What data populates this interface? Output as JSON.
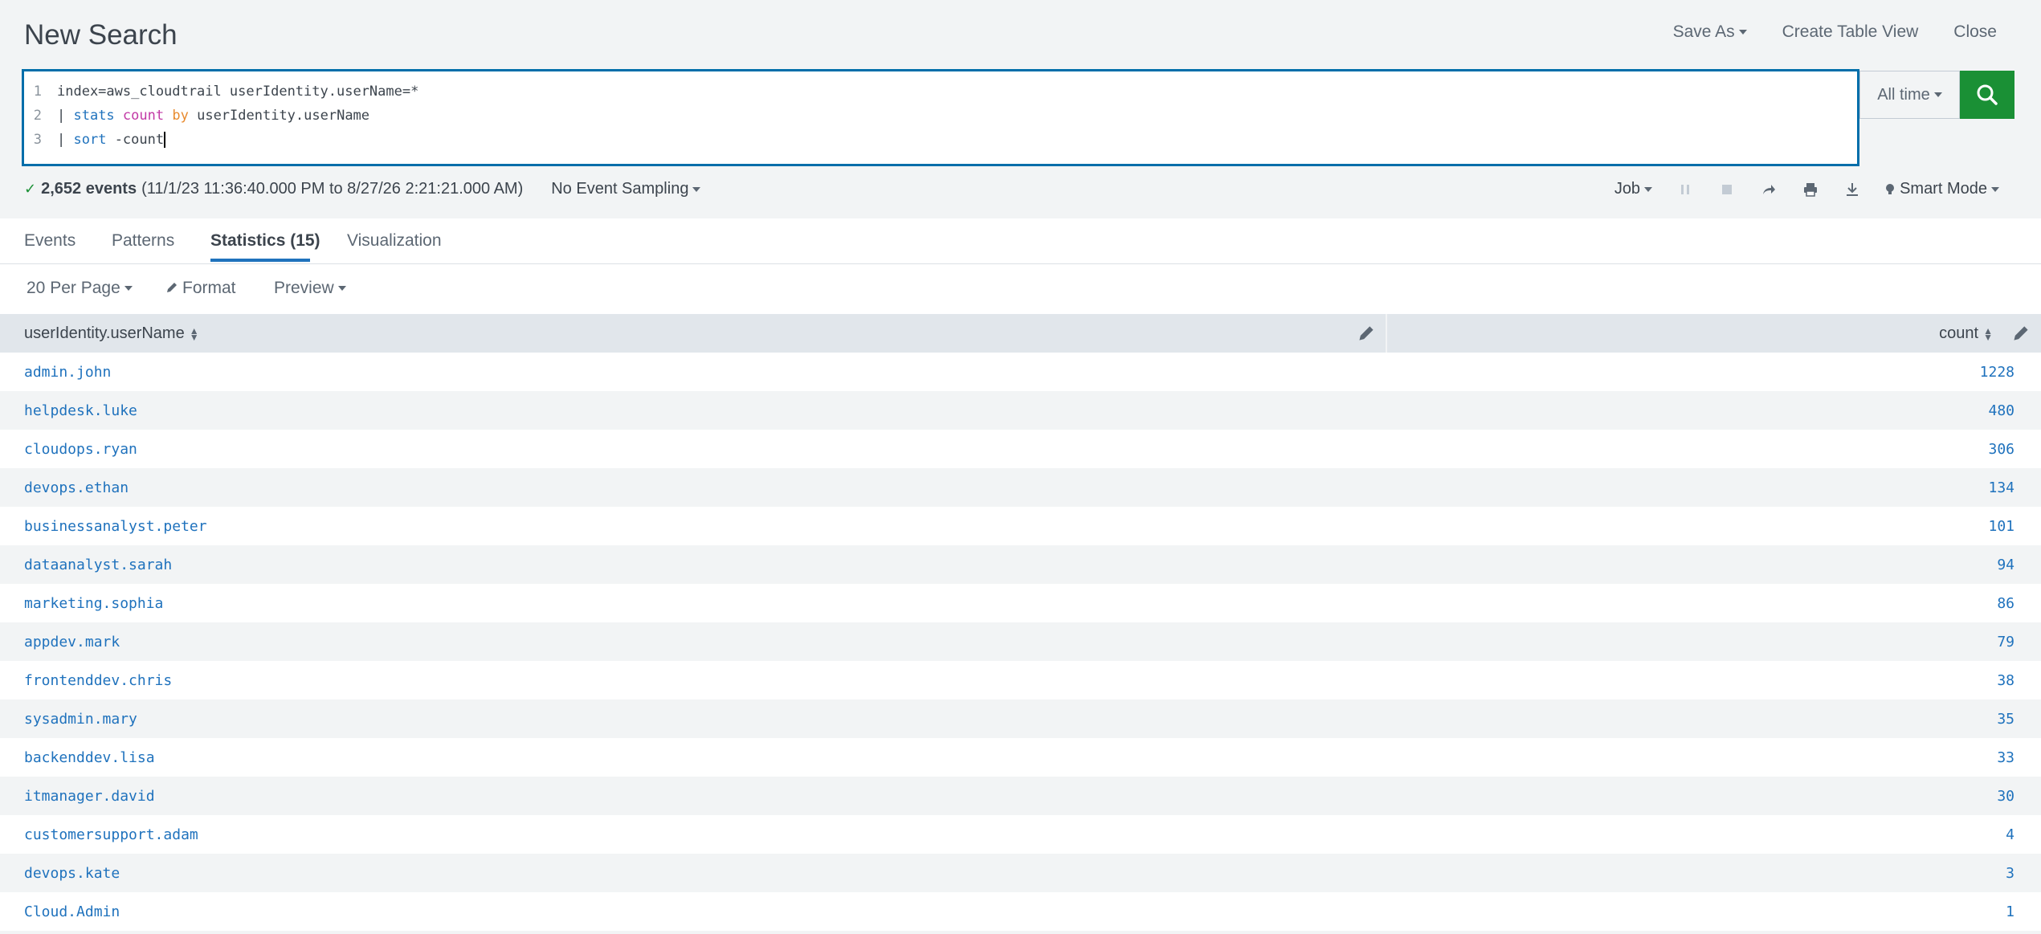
{
  "header": {
    "title": "New Search",
    "save_as": "Save As",
    "create_table_view": "Create Table View",
    "close": "Close"
  },
  "query": {
    "line_numbers": [
      "1",
      "2",
      "3"
    ],
    "line1": "index=aws_cloudtrail userIdentity.userName=*",
    "line2": {
      "pipe": "| ",
      "cmd": "stats",
      "fn": "count",
      "kw": "by",
      "field": "userIdentity.userName"
    },
    "line3": {
      "pipe": "| ",
      "cmd": "sort",
      "arg": "-count"
    }
  },
  "time_picker": {
    "label": "All time"
  },
  "status": {
    "events_count": "2,652 events",
    "events_range": "(11/1/23 11:36:40.000 PM to 8/27/26 2:21:21.000 AM)",
    "sampling": "No Event Sampling",
    "job": "Job",
    "mode": "Smart Mode"
  },
  "tabs": [
    {
      "label": "Events"
    },
    {
      "label": "Patterns"
    },
    {
      "label": "Statistics (15)"
    },
    {
      "label": "Visualization"
    }
  ],
  "active_tab": "Statistics (15)",
  "controls": {
    "per_page": "20 Per Page",
    "format": "Format",
    "preview": "Preview"
  },
  "table": {
    "columns": [
      "userIdentity.userName",
      "count"
    ],
    "rows": [
      {
        "name": "admin.john",
        "count": "1228"
      },
      {
        "name": "helpdesk.luke",
        "count": "480"
      },
      {
        "name": "cloudops.ryan",
        "count": "306"
      },
      {
        "name": "devops.ethan",
        "count": "134"
      },
      {
        "name": "businessanalyst.peter",
        "count": "101"
      },
      {
        "name": "dataanalyst.sarah",
        "count": "94"
      },
      {
        "name": "marketing.sophia",
        "count": "86"
      },
      {
        "name": "appdev.mark",
        "count": "79"
      },
      {
        "name": "frontenddev.chris",
        "count": "38"
      },
      {
        "name": "sysadmin.mary",
        "count": "35"
      },
      {
        "name": "backenddev.lisa",
        "count": "33"
      },
      {
        "name": "itmanager.david",
        "count": "30"
      },
      {
        "name": "customersupport.adam",
        "count": "4"
      },
      {
        "name": "devops.kate",
        "count": "3"
      },
      {
        "name": "Cloud.Admin",
        "count": "1"
      }
    ]
  },
  "colors": {
    "accent": "#006eaa",
    "search_button": "#1a9035",
    "link": "#1f72bd",
    "spl_command": "#1f72bd",
    "spl_function": "#c239a6",
    "spl_keyword": "#e88b2f"
  },
  "icons": {
    "search": "magnifier-icon",
    "pause": "pause-icon",
    "stop": "stop-icon",
    "share": "share-icon",
    "print": "print-icon",
    "export": "download-icon",
    "mode": "lightbulb-icon",
    "format": "pencil-icon",
    "sort": "sort-icon",
    "column_edit": "pencil-icon"
  }
}
